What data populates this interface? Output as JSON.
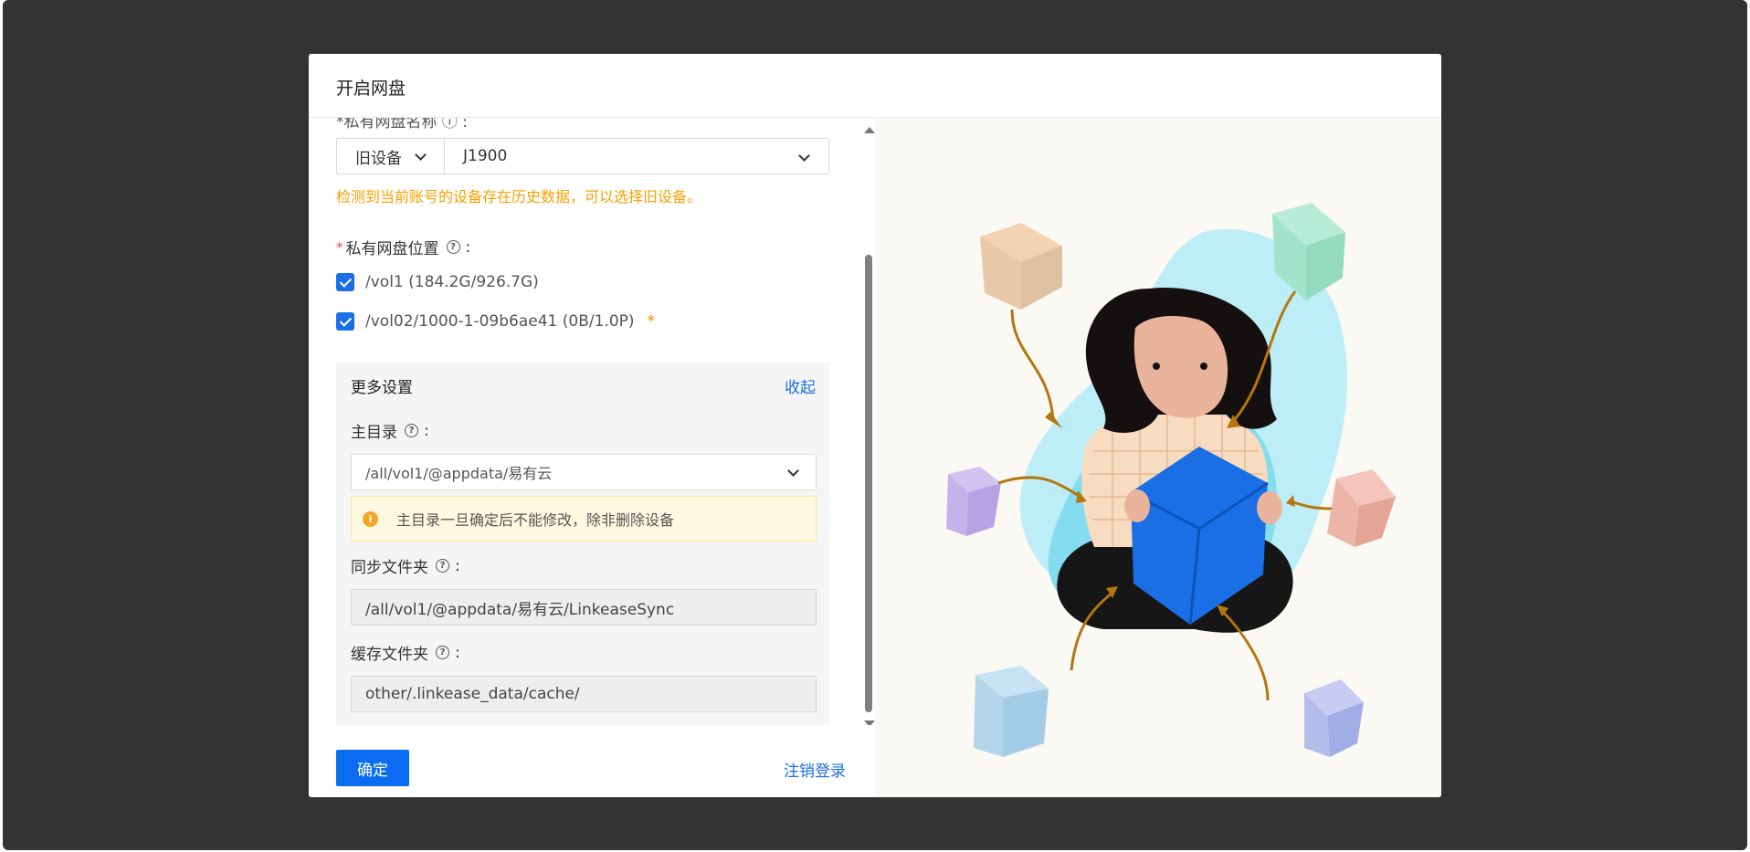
{
  "modal": {
    "title": "开启网盘"
  },
  "cut_label": "*私有网盘名称 ⓘ :",
  "device": {
    "type": "旧设备",
    "name": "J1900",
    "warning": "检测到当前账号的设备存在历史数据，可以选择旧设备。"
  },
  "location": {
    "label": "私有网盘位置",
    "options": [
      {
        "label": "/vol1 (184.2G/926.7G)",
        "checked": true
      },
      {
        "label": "/vol02/1000-1-09b6ae41 (0B/1.0P)",
        "checked": true,
        "marker": "*"
      }
    ]
  },
  "more": {
    "title": "更多设置",
    "collapse": "收起",
    "home_label": "主目录",
    "home_value": "/all/vol1/@appdata/易有云",
    "alert": "主目录一旦确定后不能修改，除非删除设备",
    "sync_label": "同步文件夹",
    "sync_value": "/all/vol1/@appdata/易有云/LinkeaseSync",
    "cache_label": "缓存文件夹",
    "cache_value": "other/.linkease_data/cache/"
  },
  "footer": {
    "confirm": "确定",
    "logout": "注销登录"
  },
  "colors": {
    "accent": "#0b6cf1",
    "warning": "#f5a100",
    "overlay": "#333333"
  }
}
